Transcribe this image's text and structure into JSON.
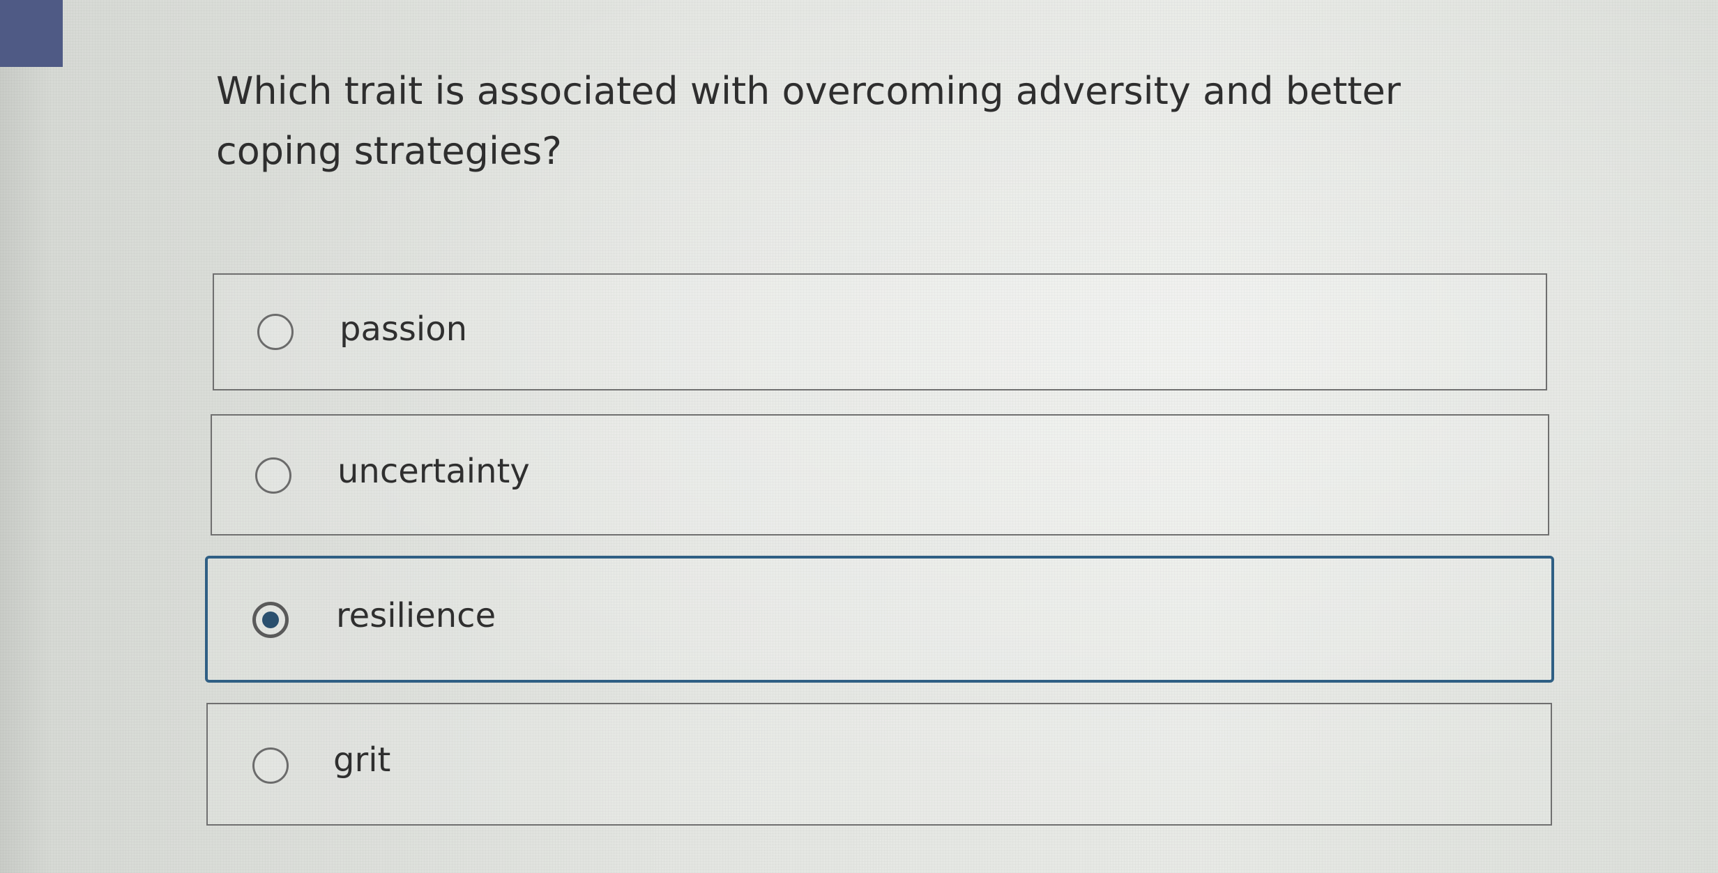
{
  "question": {
    "text": "Which trait is associated with overcoming adversity and better coping strategies?"
  },
  "options": [
    {
      "label": "passion",
      "selected": false
    },
    {
      "label": "uncertainty",
      "selected": false
    },
    {
      "label": "resilience",
      "selected": true
    },
    {
      "label": "grit",
      "selected": false
    }
  ],
  "colors": {
    "selected_border": "#2f5f84",
    "radio_fill": "#2a4f6e",
    "corner_block": "#4f5a85"
  }
}
